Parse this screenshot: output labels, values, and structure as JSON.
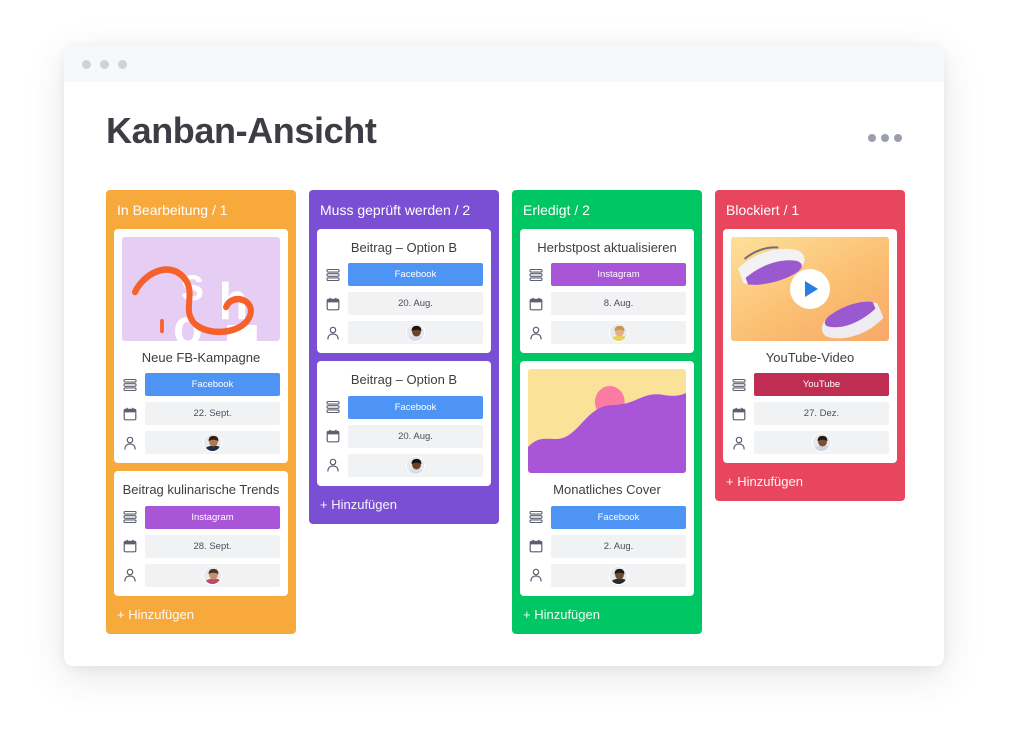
{
  "window": {
    "traffic_lights": [
      "dot",
      "dot",
      "dot"
    ],
    "more_menu_icon": "ellipsis-horizontal-icon"
  },
  "header": {
    "title": "Kanban-Ansicht"
  },
  "icons": {
    "tag": "stacked-rows-icon",
    "date": "calendar-icon",
    "assignee": "person-icon",
    "play": "play-icon"
  },
  "colors": {
    "in_progress": "#F7A93B",
    "needs_review": "#7B4FD3",
    "done": "#00C763",
    "blocked": "#E8455E",
    "facebook": "#4E94F5",
    "instagram": "#A855D8",
    "youtube": "#BF2E52",
    "title_text": "#3D3D44",
    "field_bg": "#F1F2F4"
  },
  "board": {
    "add_label": "+ Hinzufügen",
    "columns": [
      {
        "name": "in-progress",
        "title": "In Bearbeitung / 1",
        "color": "#F7A93B",
        "add_label": "+ Hinzufügen",
        "cards": [
          {
            "title": "Neue FB-Kampagne",
            "thumb": "shop-illustration",
            "tag": "Facebook",
            "tag_color": "#4E94F5",
            "date": "22. Sept.",
            "assignee": "avatar-man-beard"
          },
          {
            "title": "Beitrag kulinarische Trends",
            "thumb": null,
            "tag": "Instagram",
            "tag_color": "#A855D8",
            "date": "28. Sept.",
            "assignee": "avatar-man-glasses"
          }
        ]
      },
      {
        "name": "needs-review",
        "title": "Muss geprüft werden / 2",
        "color": "#7B4FD3",
        "add_label": "+ Hinzufügen",
        "cards": [
          {
            "title": "Beitrag – Option B",
            "thumb": null,
            "tag": "Facebook",
            "tag_color": "#4E94F5",
            "date": "20. Aug.",
            "assignee": "avatar-woman-dark"
          },
          {
            "title": "Beitrag – Option B",
            "thumb": null,
            "tag": "Facebook",
            "tag_color": "#4E94F5",
            "date": "20. Aug.",
            "assignee": "avatar-woman-dark"
          }
        ]
      },
      {
        "name": "done",
        "title": "Erledigt / 2",
        "color": "#00C763",
        "add_label": "+ Hinzufügen",
        "cards": [
          {
            "title": "Herbstpost aktualisieren",
            "thumb": null,
            "tag": "Instagram",
            "tag_color": "#A855D8",
            "date": "8. Aug.",
            "assignee": "avatar-woman-blonde"
          },
          {
            "title": "Monatliches Cover",
            "thumb": "cover-illustration",
            "tag": "Facebook",
            "tag_color": "#4E94F5",
            "date": "2. Aug.",
            "assignee": "avatar-man-dark"
          }
        ]
      },
      {
        "name": "blocked",
        "title": "Blockiert / 1",
        "color": "#E8455E",
        "add_label": "+ Hinzufügen",
        "cards": [
          {
            "title": "YouTube-Video",
            "thumb": "sneaker-video",
            "tag": "YouTube",
            "tag_color": "#BF2E52",
            "date": "27. Dez.",
            "assignee": "avatar-woman-curly"
          }
        ]
      }
    ]
  }
}
